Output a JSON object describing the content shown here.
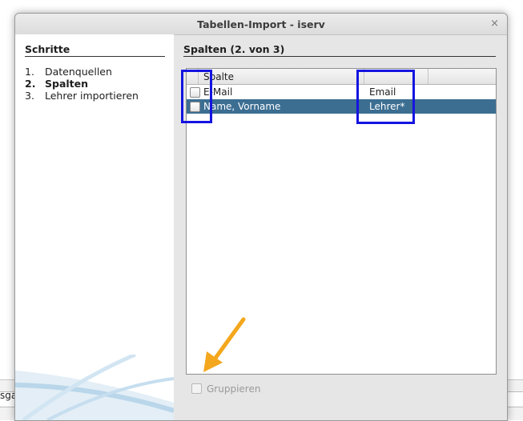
{
  "background": {
    "partial_text": "sga"
  },
  "dialog": {
    "title": "Tabellen-Import - iserv",
    "close_glyph": "×"
  },
  "steps": {
    "header": "Schritte",
    "items": [
      {
        "num": "1.",
        "label": "Datenquellen",
        "active": false
      },
      {
        "num": "2.",
        "label": "Spalten",
        "active": true
      },
      {
        "num": "3.",
        "label": "Lehrer importieren",
        "active": false
      }
    ]
  },
  "main": {
    "header": "Spalten (2. von 3)",
    "table": {
      "columns": [
        "Spalte"
      ],
      "rows": [
        {
          "name": "E-Mail",
          "type": "Email",
          "checked": false,
          "selected": false
        },
        {
          "name": "Name, Vorname",
          "type": "Lehrer*",
          "checked": false,
          "selected": true
        }
      ]
    },
    "group_label": "Gruppieren"
  },
  "colors": {
    "selection": "#3c6e92",
    "highlight_box": "#1414e0",
    "annotation_arrow": "#f4a71d"
  }
}
